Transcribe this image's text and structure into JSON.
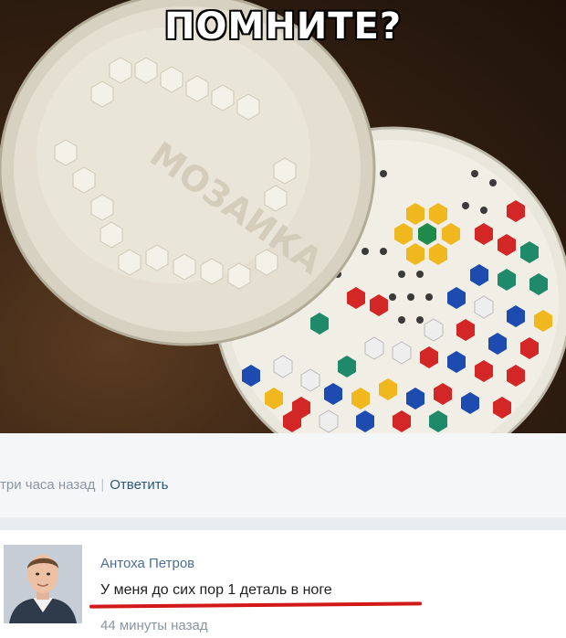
{
  "photo": {
    "caption": "ПОМНИТЕ?"
  },
  "comment_meta": {
    "time": "три часа назад",
    "separator": "|",
    "reply_label": "Ответить"
  },
  "reply": {
    "author": "Антоха Петров",
    "text": "У меня до сих пор 1 деталь в ноге",
    "time": "44 минуты назад"
  },
  "colors": {
    "link": "#2b587a",
    "muted": "#8a95a3",
    "highlight": "#d21818"
  }
}
